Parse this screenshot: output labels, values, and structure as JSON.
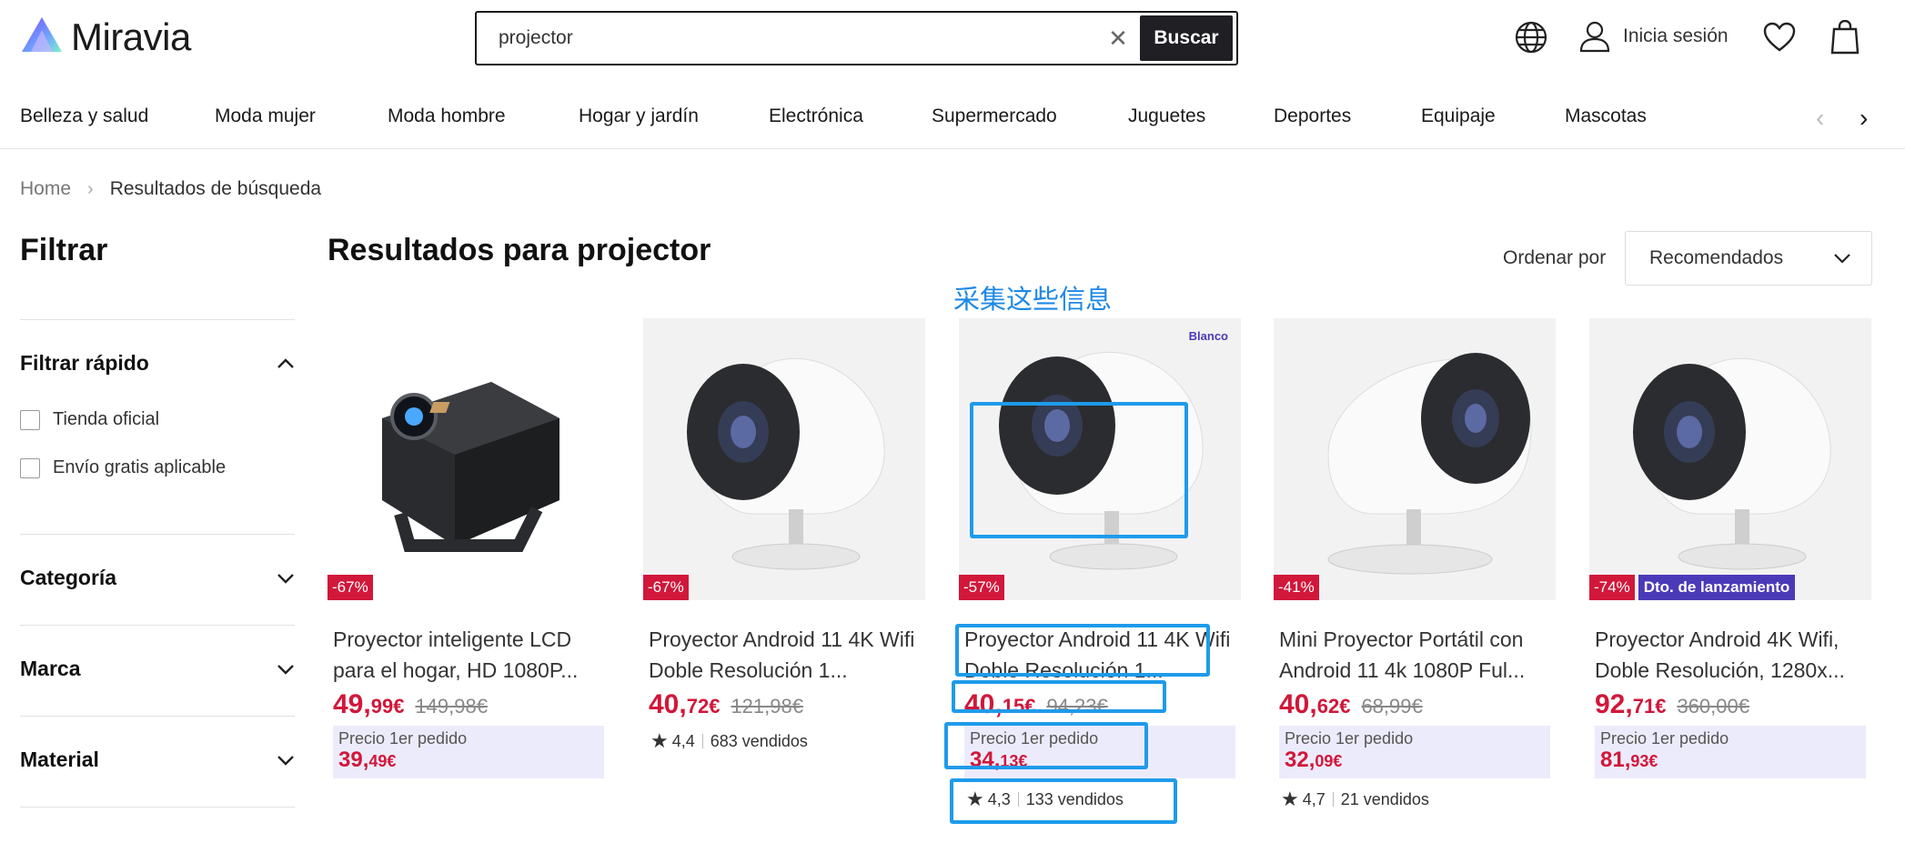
{
  "brand": {
    "name": "Miravia"
  },
  "search": {
    "value": "projector",
    "clear_icon": "close-icon",
    "button_label": "Buscar"
  },
  "header": {
    "login_label": "Inicia sesión"
  },
  "nav": {
    "items": [
      "Belleza y salud",
      "Moda mujer",
      "Moda hombre",
      "Hogar y jardín",
      "Electrónica",
      "Supermercado",
      "Juguetes",
      "Deportes",
      "Equipaje",
      "Mascotas"
    ]
  },
  "breadcrumb": {
    "home": "Home",
    "current": "Resultados de búsqueda"
  },
  "sidebar": {
    "title": "Filtrar",
    "quick_filter": {
      "title": "Filtrar rápido",
      "options": [
        "Tienda oficial",
        "Envío gratis aplicable"
      ]
    },
    "sections": [
      "Categoría",
      "Marca",
      "Material"
    ]
  },
  "results": {
    "title": "Resultados para projector",
    "sort_label": "Ordenar por",
    "sort_value": "Recomendados"
  },
  "annotation": {
    "text": "采集这些信息",
    "color": "#1e88e5"
  },
  "products": [
    {
      "discount": "-67%",
      "title": "Proyector inteligente LCD para el hogar, HD 1080P...",
      "price_int": "49,",
      "price_cents": "99€",
      "old_price": "149,98€",
      "first_order_label": "Precio 1er pedido",
      "fo_int": "39,",
      "fo_cents": "49€"
    },
    {
      "discount": "-67%",
      "title": "Proyector Android 11 4K Wifi Doble Resolución 1...",
      "price_int": "40,",
      "price_cents": "72€",
      "old_price": "121,98€",
      "rating": "4,4",
      "sold": "683 vendidos"
    },
    {
      "discount": "-57%",
      "tag": "Blanco",
      "title": "Proyector Android 11 4K Wifi Doble Resolución 1...",
      "price_int": "40,",
      "price_cents": "15€",
      "old_price": "94,23€",
      "first_order_label": "Precio 1er pedido",
      "fo_int": "34,",
      "fo_cents": "13€",
      "rating": "4,3",
      "sold": "133 vendidos"
    },
    {
      "discount": "-41%",
      "title": "Mini Proyector Portátil con Android 11 4k 1080P Ful...",
      "price_int": "40,",
      "price_cents": "62€",
      "old_price": "68,99€",
      "first_order_label": "Precio 1er pedido",
      "fo_int": "32,",
      "fo_cents": "09€",
      "rating": "4,7",
      "sold": "21 vendidos"
    },
    {
      "discount": "-74%",
      "launch_badge": "Dto. de lanzamiento",
      "title": "Proyector Android 4K Wifi, Doble Resolución, 1280x...",
      "price_int": "92,",
      "price_cents": "71€",
      "old_price": "360,00€",
      "first_order_label": "Precio 1er pedido",
      "fo_int": "81,",
      "fo_cents": "93€"
    }
  ],
  "colors": {
    "price": "#d1173a",
    "badge_launch": "#4b3ab8",
    "first_order_bg": "#ecebfb",
    "annotation_box": "#1e9bea"
  }
}
